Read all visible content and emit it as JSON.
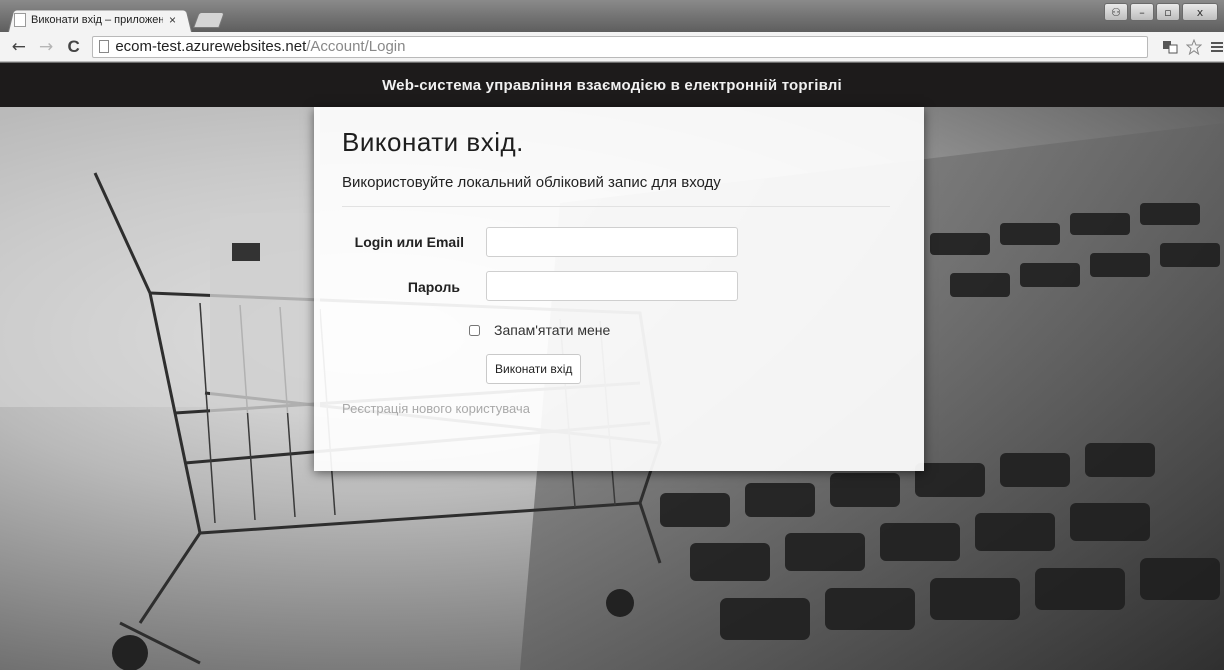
{
  "browser": {
    "tab_title": "Виконати вхід – приложени",
    "tab_close": "×",
    "url_host": "ecom-test.azurewebsites.net",
    "url_path": "/Account/Login",
    "back": "←",
    "forward": "→",
    "reload": "C",
    "window_controls": [
      "⚇",
      "–",
      "▫",
      "x"
    ],
    "toolbar_icons": [
      "translate-icon",
      "star-icon",
      "menu-icon"
    ]
  },
  "app": {
    "title": "Web-система управління взаємодією в електронній торгівлі"
  },
  "login": {
    "heading": "Виконати вхід.",
    "subheading": "Використовуйте локальний обліковий запис для входу",
    "login_label": "Login или Email",
    "login_value": "",
    "password_label": "Пароль",
    "password_value": "",
    "remember_label": "Запам'ятати мене",
    "remember_checked": false,
    "submit_label": "Виконати вхід",
    "register_link": "Реєстрація нового користувача"
  },
  "colors": {
    "appbar_bg": "#1d1b1b",
    "link": "#a9a9a9"
  }
}
